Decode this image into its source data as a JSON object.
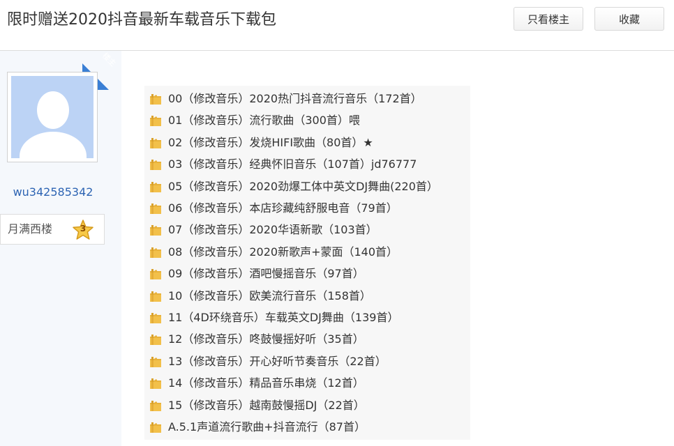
{
  "thread": {
    "title": "限时赠送2020抖音最新车载音乐下载包",
    "only_owner_label": "只看楼主",
    "collect_label": "收藏"
  },
  "author": {
    "badge": "楼主",
    "username": "wu342585342",
    "level_name": "月满西楼",
    "level_number": "3"
  },
  "folders": [
    {
      "label": "00（修改音乐）2020热门抖音流行音乐（172首）",
      "icon": "folder-icon"
    },
    {
      "label": "01（修改音乐）流行歌曲（300首）喂",
      "icon": "folder-icon"
    },
    {
      "label": "02（修改音乐）发烧HIFI歌曲（80首）★",
      "icon": "folder-icon"
    },
    {
      "label": "03（修改音乐）经典怀旧音乐（107首）jd76777",
      "icon": "folder-icon"
    },
    {
      "label": "05（修改音乐）2020劲爆工体中英文DJ舞曲(220首）",
      "icon": "folder-icon"
    },
    {
      "label": "06（修改音乐）本店珍藏纯舒服电音（79首）",
      "icon": "folder-icon"
    },
    {
      "label": "07（修改音乐）2020华语新歌（103首）",
      "icon": "folder-icon"
    },
    {
      "label": "08（修改音乐）2020新歌声+蒙面（140首）",
      "icon": "folder-icon"
    },
    {
      "label": "09（修改音乐）酒吧慢摇音乐（97首）",
      "icon": "folder-icon"
    },
    {
      "label": "10（修改音乐）欧美流行音乐（158首）",
      "icon": "folder-icon"
    },
    {
      "label": "11（4D环绕音乐）车载英文DJ舞曲（139首）",
      "icon": "folder-icon"
    },
    {
      "label": "12（修改音乐）咚鼓慢摇好听（35首）",
      "icon": "folder-icon"
    },
    {
      "label": "13（修改音乐）开心好听节奏音乐（22首）",
      "icon": "folder-icon"
    },
    {
      "label": "14（修改音乐）精品音乐串烧（12首）",
      "icon": "folder-icon"
    },
    {
      "label": "15（修改音乐）越南鼓慢摇DJ（22首）",
      "icon": "folder-icon"
    },
    {
      "label": "A.5.1声道流行歌曲+抖音流行（87首）",
      "icon": "folder-icon"
    }
  ],
  "colors": {
    "accent_blue": "#3a7fd5",
    "username_blue": "#2d64b3",
    "folder_yellow": "#f2c04a"
  }
}
